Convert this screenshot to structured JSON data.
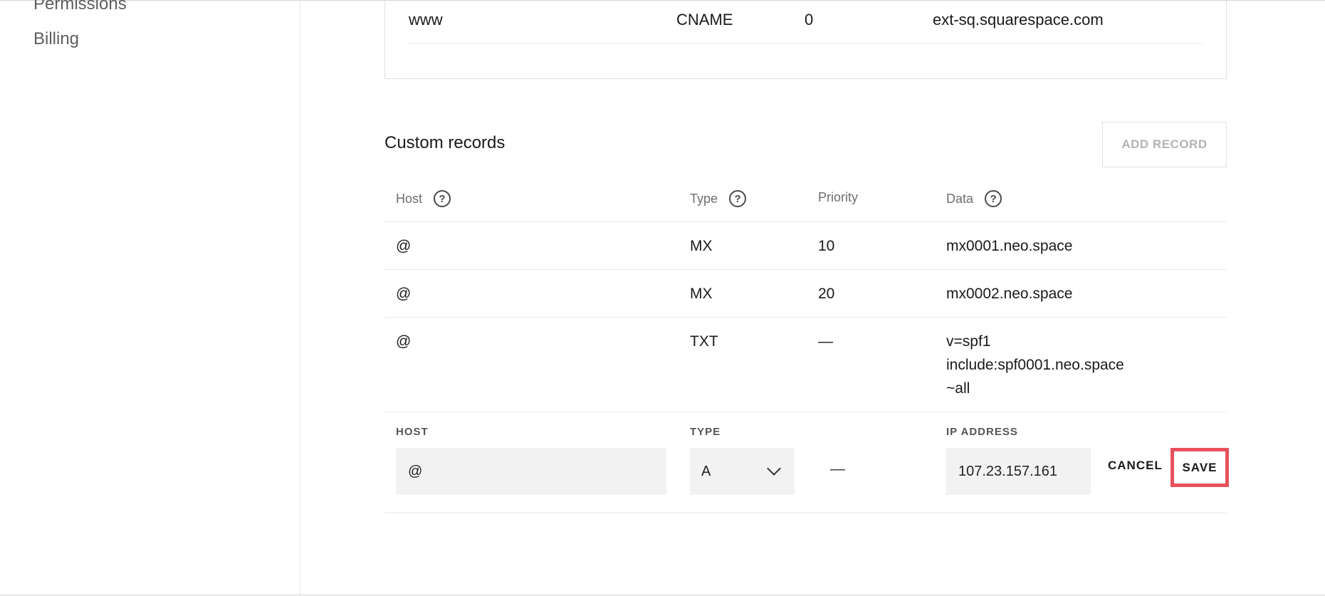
{
  "sidebar": {
    "items": [
      {
        "label": "Permissions"
      },
      {
        "label": "Billing"
      }
    ]
  },
  "top_card": {
    "row": {
      "host": "www",
      "type": "CNAME",
      "priority": "0",
      "data": "ext-sq.squarespace.com"
    }
  },
  "custom_records": {
    "title": "Custom records",
    "add_button": "ADD RECORD",
    "headers": {
      "host": "Host",
      "type": "Type",
      "priority": "Priority",
      "data": "Data"
    },
    "help_glyph": "?",
    "rows": [
      {
        "host": "@",
        "type": "MX",
        "priority": "10",
        "data": "mx0001.neo.space"
      },
      {
        "host": "@",
        "type": "MX",
        "priority": "20",
        "data": "mx0002.neo.space"
      },
      {
        "host": "@",
        "type": "TXT",
        "priority": "—",
        "data": "v=spf1\ninclude:spf0001.neo.space\n~all"
      }
    ]
  },
  "edit_row": {
    "host_label": "HOST",
    "type_label": "TYPE",
    "ip_label": "IP ADDRESS",
    "host_value": "@",
    "type_value": "A",
    "priority_value": "—",
    "ip_value": "107.23.157.161",
    "cancel_label": "CANCEL",
    "save_label": "SAVE"
  },
  "colors": {
    "save_highlight": "#e8515c",
    "field_bg": "#f2f2f2",
    "muted_text": "#6d6d6d"
  },
  "icons": {
    "help": "help-circle-icon",
    "dropdown": "chevron-down-icon"
  }
}
